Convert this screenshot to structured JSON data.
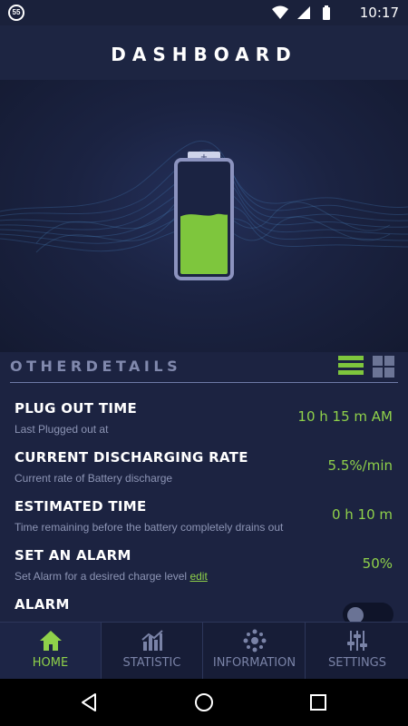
{
  "status_bar": {
    "badge": "55",
    "time": "10:17"
  },
  "header": {
    "title": "DASHBOARD"
  },
  "battery": {
    "charge_fraction": 0.55,
    "fill_color": "#7ec63d"
  },
  "details": {
    "section_title": "OTHERDETAILS",
    "rows": [
      {
        "label": "PLUG OUT TIME",
        "sub": "Last Plugged out at",
        "value": "10 h 15 m AM"
      },
      {
        "label": "CURRENT DISCHARGING RATE",
        "sub": "Current rate of Battery discharge",
        "value": "5.5%/min"
      },
      {
        "label": "ESTIMATED TIME",
        "sub": "Time remaining before the battery completely drains out",
        "value": "0 h 10 m"
      },
      {
        "label": "SET AN ALARM",
        "sub": "Set Alarm for a desired charge level",
        "sub_link": "edit",
        "value": "50%"
      },
      {
        "label": "ALARM",
        "toggle_on": false
      }
    ]
  },
  "tabs": [
    {
      "label": "HOME",
      "icon": "home-icon",
      "active": true
    },
    {
      "label": "STATISTIC",
      "icon": "bar-chart-icon",
      "active": false
    },
    {
      "label": "INFORMATION",
      "icon": "dots-cluster-icon",
      "active": false
    },
    {
      "label": "SETTINGS",
      "icon": "sliders-icon",
      "active": false
    }
  ],
  "colors": {
    "accent": "#8fd14a",
    "background": "#1c2341",
    "muted_text": "#8d95b5"
  }
}
